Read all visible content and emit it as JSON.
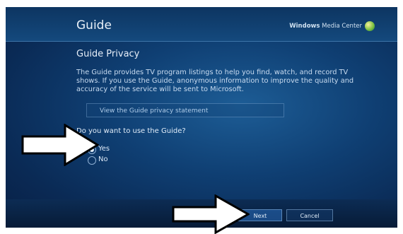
{
  "header": {
    "title": "Guide",
    "brand_light": "Windows",
    "brand_rest": " Media Center"
  },
  "section": {
    "title": "Guide Privacy"
  },
  "description": "The Guide provides TV program listings to help you find, watch, and record TV shows. If you use the Guide, anonymous information to improve the quality and accuracy of the service will be sent to Microsoft.",
  "privacy_link": "View the Guide privacy statement",
  "question": "Do you want to use the Guide?",
  "options": [
    {
      "label": "Yes",
      "selected": true
    },
    {
      "label": "No",
      "selected": false
    }
  ],
  "buttons": {
    "next": "Next",
    "cancel": "Cancel"
  },
  "colors": {
    "background": "#0f3f73",
    "accent": "#2a6ebc",
    "text": "#e0ecf8"
  }
}
